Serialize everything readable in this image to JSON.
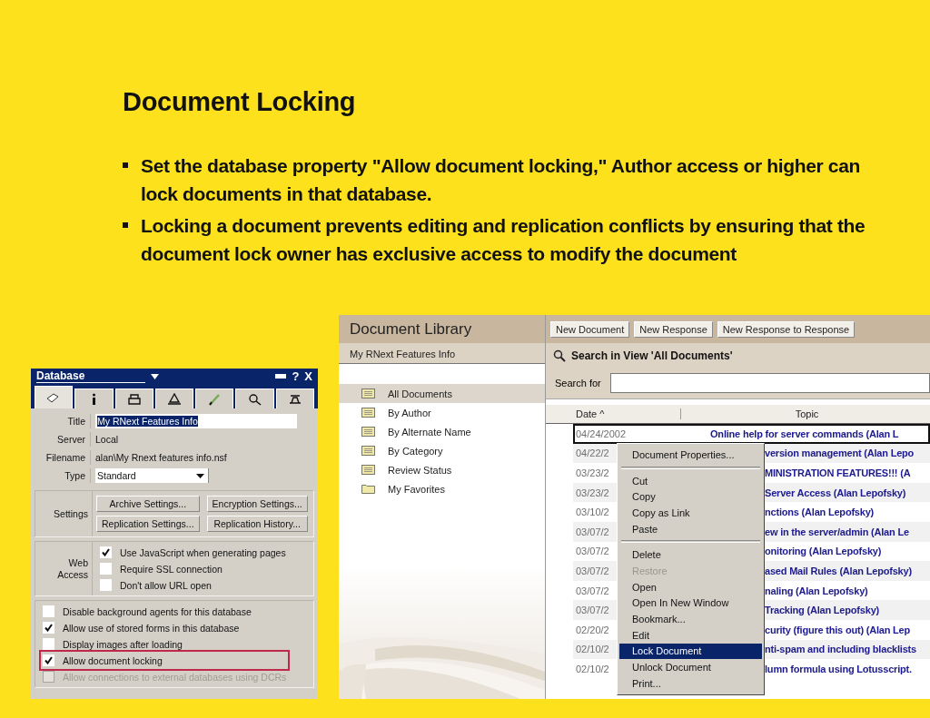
{
  "slide": {
    "title": "Document Locking",
    "bullets": [
      "Set the database property \"Allow document locking,\" Author access or higher can lock documents in that database.",
      "Locking a document prevents editing and replication conflicts by ensuring that the document lock owner has exclusive access to modify the document"
    ]
  },
  "properties_box": {
    "title": "Database",
    "help": "?",
    "close": "X",
    "tabs": [
      {
        "selected": true
      },
      {
        "selected": false
      },
      {
        "selected": false
      },
      {
        "selected": false
      },
      {
        "selected": false
      },
      {
        "selected": false
      },
      {
        "selected": false
      }
    ],
    "fields": [
      {
        "label": "Title",
        "value": "My RNext Features Info",
        "kind": "input"
      },
      {
        "label": "Server",
        "value": "Local",
        "kind": "text"
      },
      {
        "label": "Filename",
        "value": "alan\\My Rnext features info.nsf",
        "kind": "text"
      },
      {
        "label": "Type",
        "value": "Standard",
        "kind": "select"
      }
    ],
    "settings": {
      "label": "Settings",
      "buttons": [
        "Archive Settings...",
        "Encryption Settings...",
        "Replication Settings...",
        "Replication History..."
      ]
    },
    "web_access": {
      "label": "Web Access",
      "options": [
        {
          "label": "Use JavaScript when generating pages",
          "checked": true
        },
        {
          "label": "Require SSL connection",
          "checked": false
        },
        {
          "label": "Don't allow URL open",
          "checked": false
        }
      ]
    },
    "options": [
      {
        "label": "Disable background agents for this database",
        "checked": false,
        "disabled": false,
        "highlighted": false
      },
      {
        "label": "Allow use of stored forms in this database",
        "checked": true,
        "disabled": false,
        "highlighted": false
      },
      {
        "label": "Display images after loading",
        "checked": false,
        "disabled": false,
        "highlighted": false
      },
      {
        "label": "Allow document locking",
        "checked": true,
        "disabled": false,
        "highlighted": true
      },
      {
        "label": "Allow connections to external databases using DCRs",
        "checked": false,
        "disabled": true,
        "highlighted": false
      }
    ]
  },
  "library": {
    "title": "Document Library",
    "subtitle": "My RNext Features Info",
    "views": [
      {
        "label": "All Documents",
        "kind": "view",
        "selected": true
      },
      {
        "label": "By Author",
        "kind": "view",
        "selected": false
      },
      {
        "label": "By Alternate Name",
        "kind": "view",
        "selected": false
      },
      {
        "label": "By Category",
        "kind": "view",
        "selected": false
      },
      {
        "label": "Review Status",
        "kind": "view",
        "selected": false
      },
      {
        "label": "My Favorites",
        "kind": "folder",
        "selected": false
      }
    ],
    "toolbar": [
      "New Document",
      "New Response",
      "New Response to Response"
    ],
    "search": {
      "title": "Search in View 'All Documents'",
      "label": "Search for"
    },
    "columns": [
      "Date ^",
      "Topic"
    ],
    "rows": [
      {
        "date": "04/24/2002",
        "topic": "Online help for server commands (Alan L",
        "selected": true
      },
      {
        "date": "04/22/2",
        "topic": "version management (Alan Lepo",
        "selected": false
      },
      {
        "date": "03/23/2",
        "topic": "MINISTRATION FEATURES!!! (A",
        "selected": false
      },
      {
        "date": "03/23/2",
        "topic": "Server Access (Alan Lepofsky)",
        "selected": false
      },
      {
        "date": "03/10/2",
        "topic": "nctions (Alan Lepofsky)",
        "selected": false
      },
      {
        "date": "03/07/2",
        "topic": "ew in the server/admin (Alan Le",
        "selected": false
      },
      {
        "date": "03/07/2",
        "topic": "onitoring (Alan Lepofsky)",
        "selected": false
      },
      {
        "date": "03/07/2",
        "topic": "ased Mail Rules (Alan Lepofsky)",
        "selected": false
      },
      {
        "date": "03/07/2",
        "topic": "naling (Alan Lepofsky)",
        "selected": false
      },
      {
        "date": "03/07/2",
        "topic": "Tracking (Alan Lepofsky)",
        "selected": false
      },
      {
        "date": "02/20/2",
        "topic": "curity (figure this out) (Alan Lep",
        "selected": false
      },
      {
        "date": "02/10/2",
        "topic": "nti-spam and including blacklists",
        "selected": false
      },
      {
        "date": "02/10/2",
        "topic": "lumn formula using Lotusscript.",
        "selected": false
      }
    ],
    "context_menu": [
      {
        "kind": "item",
        "label": "Document Properties...",
        "disabled": false,
        "selected": false
      },
      {
        "kind": "separator"
      },
      {
        "kind": "item",
        "label": "Cut",
        "disabled": false,
        "selected": false
      },
      {
        "kind": "item",
        "label": "Copy",
        "disabled": false,
        "selected": false
      },
      {
        "kind": "item",
        "label": "Copy as Link",
        "disabled": false,
        "selected": false
      },
      {
        "kind": "item",
        "label": "Paste",
        "disabled": false,
        "selected": false
      },
      {
        "kind": "separator"
      },
      {
        "kind": "item",
        "label": "Delete",
        "disabled": false,
        "selected": false
      },
      {
        "kind": "item",
        "label": "Restore",
        "disabled": true,
        "selected": false
      },
      {
        "kind": "item",
        "label": "Open",
        "disabled": false,
        "selected": false
      },
      {
        "kind": "item",
        "label": "Open In New Window",
        "disabled": false,
        "selected": false
      },
      {
        "kind": "item",
        "label": "Bookmark...",
        "disabled": false,
        "selected": false
      },
      {
        "kind": "item",
        "label": "Edit",
        "disabled": false,
        "selected": false
      },
      {
        "kind": "item",
        "label": "Lock Document",
        "disabled": false,
        "selected": true
      },
      {
        "kind": "item",
        "label": "Unlock Document",
        "disabled": false,
        "selected": false
      },
      {
        "kind": "item",
        "label": "Print...",
        "disabled": false,
        "selected": false
      }
    ]
  }
}
